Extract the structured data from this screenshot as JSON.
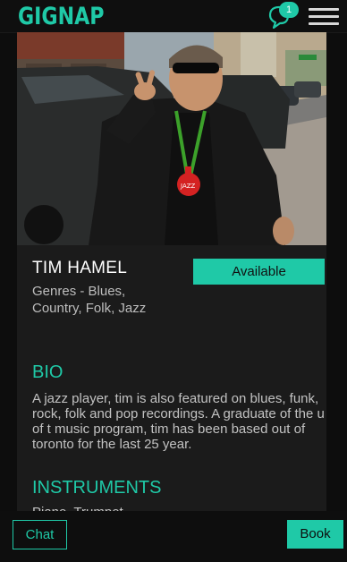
{
  "header": {
    "logo_text": "GIGNAP",
    "notification_count": "1",
    "chat_icon": "chat-bubble-icon",
    "menu_icon": "hamburger-menu-icon"
  },
  "profile": {
    "photo": "musician-photo",
    "name": "TIM HAMEL",
    "genres": "Genres - Blues, Country, Folk, Jazz",
    "status_button": "Available"
  },
  "bio": {
    "heading": "BIO",
    "text": "A jazz player, tim is also featured on blues, funk, rock, folk and pop recordings. A graduate of the u of t music program, tim has been based out of toronto for the last 25 year."
  },
  "instruments": {
    "heading": "INSTRUMENTS",
    "text": "Piano, Trumpet"
  },
  "footer": {
    "chat_label": "Chat",
    "book_label": "Book"
  },
  "colors": {
    "accent": "#1fc9a7",
    "background": "#0d0d0d",
    "card": "#1b1b1b"
  }
}
